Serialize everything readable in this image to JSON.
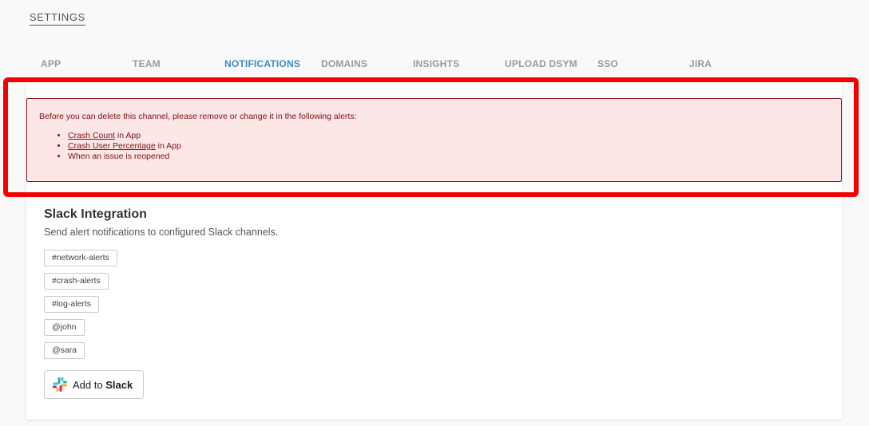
{
  "header": {
    "title": "SETTINGS"
  },
  "tabs": [
    {
      "label": "APP"
    },
    {
      "label": "TEAM"
    },
    {
      "label": "NOTIFICATIONS"
    },
    {
      "label": "DOMAINS"
    },
    {
      "label": "INSIGHTS"
    },
    {
      "label": "UPLOAD DSYM"
    },
    {
      "label": "SSO"
    },
    {
      "label": "JIRA"
    }
  ],
  "active_tab": "NOTIFICATIONS",
  "alert": {
    "message": "Before you can delete this channel, please remove or change it in the following alerts:",
    "items": [
      {
        "link": "Crash Count",
        "suffix": " in App"
      },
      {
        "link": "Crash User Percentage",
        "suffix": " in App"
      },
      {
        "text": "When an issue is reopened"
      }
    ]
  },
  "slack": {
    "title": "Slack Integration",
    "description": "Send alert notifications to configured Slack channels.",
    "channels": [
      "#network-alerts",
      "#crash-alerts",
      "#log-alerts",
      "@john",
      "@sara"
    ],
    "button": {
      "prefix": "Add to ",
      "brand": "Slack"
    }
  },
  "colors": {
    "accent": "#3b8cc9",
    "highlight_border": "#f50000",
    "alert_bg": "#fde6e6",
    "alert_text": "#7a1212"
  }
}
